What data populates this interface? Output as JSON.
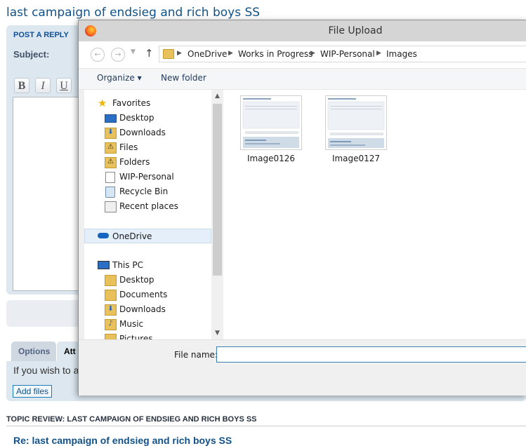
{
  "forum": {
    "topic_title": "last campaign of endsieg and rich boys SS",
    "post_heading": "POST A REPLY",
    "subject_label": "Subject:",
    "format_buttons": [
      "B",
      "I",
      "U"
    ],
    "tabs": [
      "Options",
      "Att"
    ],
    "attach_text": "If you wish to a",
    "add_files": "Add files",
    "topic_review": "TOPIC REVIEW: LAST CAMPAIGN OF ENDSIEG AND RICH BOYS SS",
    "review_post_title": "Re: last campaign of endsieg and rich boys SS"
  },
  "dialog": {
    "title": "File Upload",
    "nav": {
      "back": "←",
      "forward": "→",
      "up": "↑"
    },
    "breadcrumb": [
      "OneDrive",
      "Works in Progress",
      "WIP-Personal",
      "Images"
    ],
    "toolbar": {
      "organize": "Organize ▾",
      "new_folder": "New folder"
    },
    "favorites_label": "Favorites",
    "favorites": [
      {
        "label": "Desktop",
        "icon": "desktop-icon"
      },
      {
        "label": "Downloads",
        "icon": "downloads-folder-icon"
      },
      {
        "label": "Files",
        "icon": "warning-folder-icon"
      },
      {
        "label": "Folders",
        "icon": "warning-folder-icon"
      },
      {
        "label": "WIP-Personal",
        "icon": "document-icon"
      },
      {
        "label": "Recycle Bin",
        "icon": "recycle-bin-icon"
      },
      {
        "label": "Recent places",
        "icon": "recent-places-icon"
      }
    ],
    "onedrive_label": "OneDrive",
    "thispc_label": "This PC",
    "thispc_items": [
      {
        "label": "Desktop",
        "icon": "folder-icon"
      },
      {
        "label": "Documents",
        "icon": "folder-icon"
      },
      {
        "label": "Downloads",
        "icon": "downloads-folder-icon"
      },
      {
        "label": "Music",
        "icon": "music-folder-icon"
      },
      {
        "label": "Pictures",
        "icon": "pictures-folder-icon"
      }
    ],
    "files": [
      {
        "name": "Image0126"
      },
      {
        "name": "Image0127"
      }
    ],
    "file_name_label": "File name:",
    "file_name_value": ""
  }
}
